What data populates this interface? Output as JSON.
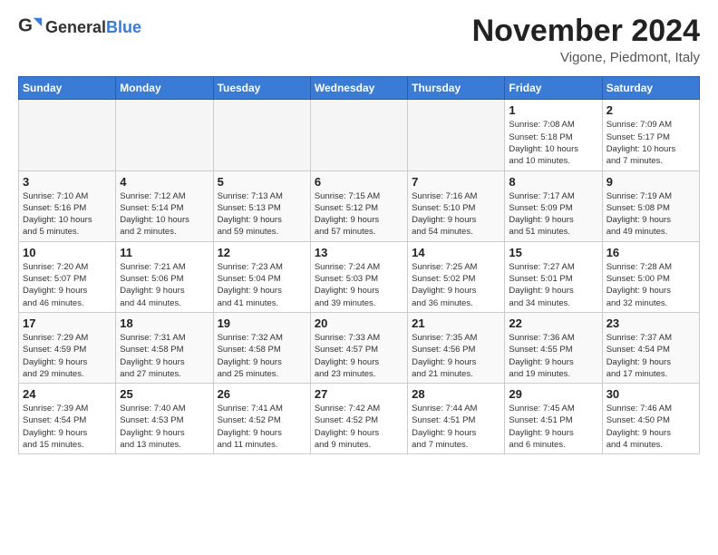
{
  "header": {
    "logo_general": "General",
    "logo_blue": "Blue",
    "month_title": "November 2024",
    "subtitle": "Vigone, Piedmont, Italy"
  },
  "weekdays": [
    "Sunday",
    "Monday",
    "Tuesday",
    "Wednesday",
    "Thursday",
    "Friday",
    "Saturday"
  ],
  "weeks": [
    [
      {
        "day": "",
        "info": ""
      },
      {
        "day": "",
        "info": ""
      },
      {
        "day": "",
        "info": ""
      },
      {
        "day": "",
        "info": ""
      },
      {
        "day": "",
        "info": ""
      },
      {
        "day": "1",
        "info": "Sunrise: 7:08 AM\nSunset: 5:18 PM\nDaylight: 10 hours\nand 10 minutes."
      },
      {
        "day": "2",
        "info": "Sunrise: 7:09 AM\nSunset: 5:17 PM\nDaylight: 10 hours\nand 7 minutes."
      }
    ],
    [
      {
        "day": "3",
        "info": "Sunrise: 7:10 AM\nSunset: 5:16 PM\nDaylight: 10 hours\nand 5 minutes."
      },
      {
        "day": "4",
        "info": "Sunrise: 7:12 AM\nSunset: 5:14 PM\nDaylight: 10 hours\nand 2 minutes."
      },
      {
        "day": "5",
        "info": "Sunrise: 7:13 AM\nSunset: 5:13 PM\nDaylight: 9 hours\nand 59 minutes."
      },
      {
        "day": "6",
        "info": "Sunrise: 7:15 AM\nSunset: 5:12 PM\nDaylight: 9 hours\nand 57 minutes."
      },
      {
        "day": "7",
        "info": "Sunrise: 7:16 AM\nSunset: 5:10 PM\nDaylight: 9 hours\nand 54 minutes."
      },
      {
        "day": "8",
        "info": "Sunrise: 7:17 AM\nSunset: 5:09 PM\nDaylight: 9 hours\nand 51 minutes."
      },
      {
        "day": "9",
        "info": "Sunrise: 7:19 AM\nSunset: 5:08 PM\nDaylight: 9 hours\nand 49 minutes."
      }
    ],
    [
      {
        "day": "10",
        "info": "Sunrise: 7:20 AM\nSunset: 5:07 PM\nDaylight: 9 hours\nand 46 minutes."
      },
      {
        "day": "11",
        "info": "Sunrise: 7:21 AM\nSunset: 5:06 PM\nDaylight: 9 hours\nand 44 minutes."
      },
      {
        "day": "12",
        "info": "Sunrise: 7:23 AM\nSunset: 5:04 PM\nDaylight: 9 hours\nand 41 minutes."
      },
      {
        "day": "13",
        "info": "Sunrise: 7:24 AM\nSunset: 5:03 PM\nDaylight: 9 hours\nand 39 minutes."
      },
      {
        "day": "14",
        "info": "Sunrise: 7:25 AM\nSunset: 5:02 PM\nDaylight: 9 hours\nand 36 minutes."
      },
      {
        "day": "15",
        "info": "Sunrise: 7:27 AM\nSunset: 5:01 PM\nDaylight: 9 hours\nand 34 minutes."
      },
      {
        "day": "16",
        "info": "Sunrise: 7:28 AM\nSunset: 5:00 PM\nDaylight: 9 hours\nand 32 minutes."
      }
    ],
    [
      {
        "day": "17",
        "info": "Sunrise: 7:29 AM\nSunset: 4:59 PM\nDaylight: 9 hours\nand 29 minutes."
      },
      {
        "day": "18",
        "info": "Sunrise: 7:31 AM\nSunset: 4:58 PM\nDaylight: 9 hours\nand 27 minutes."
      },
      {
        "day": "19",
        "info": "Sunrise: 7:32 AM\nSunset: 4:58 PM\nDaylight: 9 hours\nand 25 minutes."
      },
      {
        "day": "20",
        "info": "Sunrise: 7:33 AM\nSunset: 4:57 PM\nDaylight: 9 hours\nand 23 minutes."
      },
      {
        "day": "21",
        "info": "Sunrise: 7:35 AM\nSunset: 4:56 PM\nDaylight: 9 hours\nand 21 minutes."
      },
      {
        "day": "22",
        "info": "Sunrise: 7:36 AM\nSunset: 4:55 PM\nDaylight: 9 hours\nand 19 minutes."
      },
      {
        "day": "23",
        "info": "Sunrise: 7:37 AM\nSunset: 4:54 PM\nDaylight: 9 hours\nand 17 minutes."
      }
    ],
    [
      {
        "day": "24",
        "info": "Sunrise: 7:39 AM\nSunset: 4:54 PM\nDaylight: 9 hours\nand 15 minutes."
      },
      {
        "day": "25",
        "info": "Sunrise: 7:40 AM\nSunset: 4:53 PM\nDaylight: 9 hours\nand 13 minutes."
      },
      {
        "day": "26",
        "info": "Sunrise: 7:41 AM\nSunset: 4:52 PM\nDaylight: 9 hours\nand 11 minutes."
      },
      {
        "day": "27",
        "info": "Sunrise: 7:42 AM\nSunset: 4:52 PM\nDaylight: 9 hours\nand 9 minutes."
      },
      {
        "day": "28",
        "info": "Sunrise: 7:44 AM\nSunset: 4:51 PM\nDaylight: 9 hours\nand 7 minutes."
      },
      {
        "day": "29",
        "info": "Sunrise: 7:45 AM\nSunset: 4:51 PM\nDaylight: 9 hours\nand 6 minutes."
      },
      {
        "day": "30",
        "info": "Sunrise: 7:46 AM\nSunset: 4:50 PM\nDaylight: 9 hours\nand 4 minutes."
      }
    ]
  ]
}
